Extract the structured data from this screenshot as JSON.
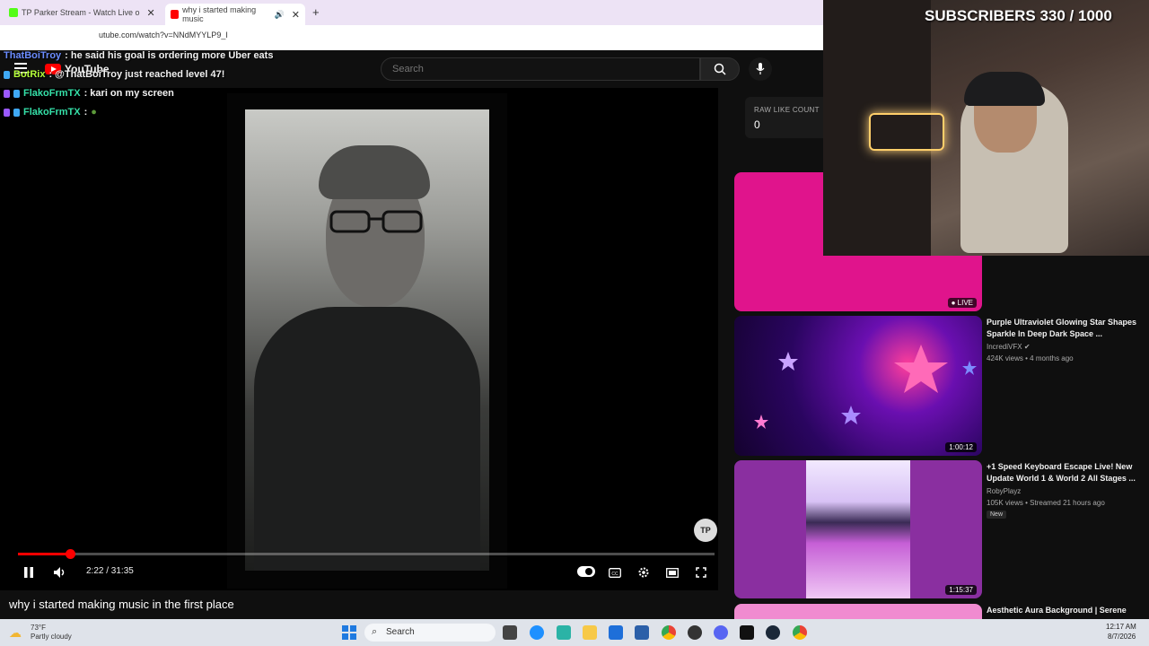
{
  "browser": {
    "tabs": [
      {
        "label": "TP Parker Stream - Watch Live o"
      },
      {
        "label": "why i started making music"
      }
    ],
    "url": "utube.com/watch?v=NNdMYYLP9_I"
  },
  "youtube": {
    "logo_text": "YouTube",
    "search_placeholder": "Search"
  },
  "chat": [
    {
      "user": "ThatBoiTroy",
      "message": ": he said his goal is ordering more Uber eats",
      "color": "#6b8cff"
    },
    {
      "user": "BotRix",
      "message": ": @ThatBoiTroy just reached level 47!",
      "color": "#b6ff3a"
    },
    {
      "user": "FlakoFrmTX",
      "message": ": kari on my screen",
      "color": "#35e0a8"
    },
    {
      "user": "FlakoFrmTX",
      "message": ":",
      "color": "#35e0a8"
    }
  ],
  "player": {
    "current_time": "2:22",
    "duration": "31:35",
    "time_display": "2:22 / 31:35",
    "progress_fraction": 0.075,
    "title": "why i started making music in the first place",
    "channel_badge": "TP"
  },
  "sidebar": {
    "like_counter": {
      "label": "RAW LIKE COUNT",
      "value": "0"
    },
    "live_badge": "LIVE",
    "videos": [
      {
        "title": "Purple Ultraviolet Glowing Star Shapes Sparkle In Deep Dark Space ...",
        "channel": "IncrediVFX",
        "meta": "424K views • 4 months ago",
        "duration": "1:00:12"
      },
      {
        "title": "+1 Speed Keyboard Escape Live! New Update World 1 & World 2 All Stages ...",
        "channel": "RobyPlayz",
        "meta": "105K views • Streamed 21 hours ago",
        "badge": "New",
        "duration": "1:15:37"
      },
      {
        "title": "Aesthetic Aura Background | Serene"
      }
    ]
  },
  "webcam": {
    "subscriber_goal": "SUBSCRIBERS 330 / 1000"
  },
  "taskbar": {
    "weather_temp": "73°F",
    "weather_desc": "Partly cloudy",
    "search_label": "Search",
    "time": "12:17 AM",
    "date": "8/7/2026"
  },
  "colors": {
    "accent_red": "#ff0000",
    "live_pink": "#e0148c"
  }
}
